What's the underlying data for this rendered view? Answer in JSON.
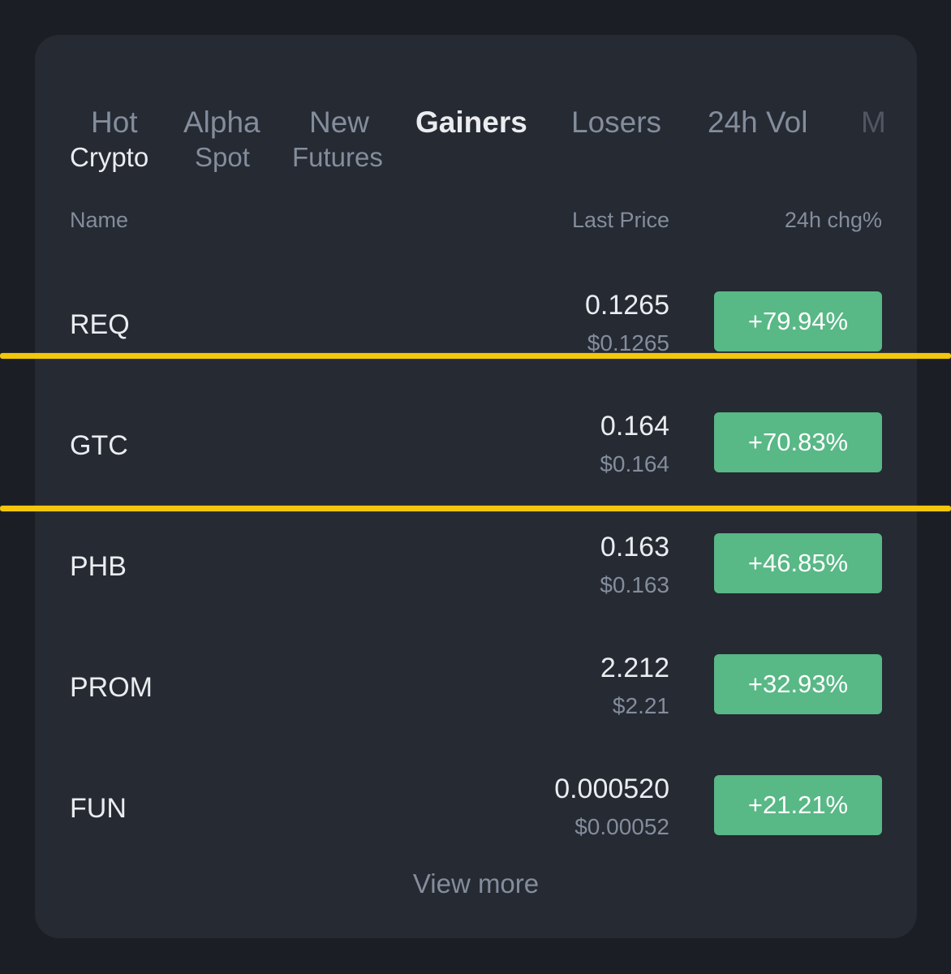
{
  "tabs": [
    {
      "label": "Hot",
      "active": false
    },
    {
      "label": "Alpha",
      "active": false
    },
    {
      "label": "New",
      "active": false
    },
    {
      "label": "Gainers",
      "active": true
    },
    {
      "label": "Losers",
      "active": false
    },
    {
      "label": "24h Vol",
      "active": false
    },
    {
      "label": "M",
      "active": false
    }
  ],
  "subtabs": [
    {
      "label": "Crypto",
      "active": true
    },
    {
      "label": "Spot",
      "active": false
    },
    {
      "label": "Futures",
      "active": false
    }
  ],
  "columns": {
    "name": "Name",
    "last_price": "Last Price",
    "change": "24h chg%"
  },
  "rows": [
    {
      "symbol": "REQ",
      "price": "0.1265",
      "usd": "$0.1265",
      "change": "+79.94%"
    },
    {
      "symbol": "GTC",
      "price": "0.164",
      "usd": "$0.164",
      "change": "+70.83%"
    },
    {
      "symbol": "PHB",
      "price": "0.163",
      "usd": "$0.163",
      "change": "+46.85%"
    },
    {
      "symbol": "PROM",
      "price": "2.212",
      "usd": "$2.21",
      "change": "+32.93%"
    },
    {
      "symbol": "FUN",
      "price": "0.000520",
      "usd": "$0.00052",
      "change": "+21.21%"
    }
  ],
  "view_more": "View more",
  "colors": {
    "background": "#1b1e24",
    "card": "#252a33",
    "text_primary": "#eaecef",
    "text_secondary": "#848d9b",
    "gain": "#58b886",
    "highlight": "#f2c70c"
  }
}
